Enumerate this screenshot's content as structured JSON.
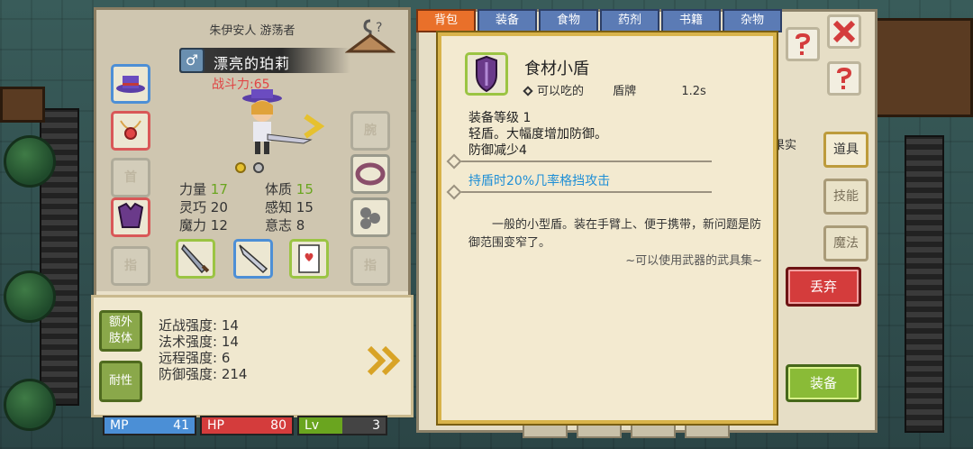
{
  "character": {
    "subtitle": "朱伊安人 游荡者",
    "name": "漂亮的珀莉",
    "gender_symbol": "♂",
    "power": "战斗力:65",
    "stats": [
      {
        "label": "力量",
        "value": "17",
        "highlight": true
      },
      {
        "label": "体质",
        "value": "15",
        "highlight": true
      },
      {
        "label": "灵巧",
        "value": "20",
        "highlight": false
      },
      {
        "label": "感知",
        "value": "15",
        "highlight": false
      },
      {
        "label": "魔力",
        "value": "12",
        "highlight": false
      },
      {
        "label": "意志",
        "value": "8",
        "highlight": false
      }
    ],
    "slot_labels": {
      "left_empty": "首",
      "right_top": "腕",
      "bottom_left": "指",
      "bottom_right": "指"
    }
  },
  "extra": {
    "btn_extra_limbs": "额外\n肢体",
    "btn_resist": "耐性",
    "strengths": [
      "近战强度: 14",
      "法术强度: 14",
      "远程强度: 6",
      "防御强度: 214"
    ]
  },
  "bars": [
    {
      "key": "MP",
      "value": "41",
      "color": "#4b8fd6",
      "fill": 1.0
    },
    {
      "key": "HP",
      "value": "80",
      "color": "#d43c3c",
      "fill": 1.0
    },
    {
      "key": "Lv",
      "value": "3",
      "color": "#6aa51f",
      "fill": 0.5
    }
  ],
  "inventory": {
    "tabs": [
      "背包",
      "装备",
      "食物",
      "药剂",
      "书籍",
      "杂物"
    ],
    "side_labels": {
      "fruit": "果实"
    },
    "right_buttons": [
      "道具",
      "技能",
      "魔法"
    ],
    "discard": "丢弃",
    "equip": "装备"
  },
  "item": {
    "title": "食材小盾",
    "meta_edible": "可以吃的",
    "meta_type": "盾牌",
    "meta_weight": "1.2s",
    "desc": [
      "装备等级 1",
      "轻盾。大幅度增加防御。",
      "防御减少4"
    ],
    "skill": "持盾时20%几率格挡攻击",
    "flavor": "一般的小型盾。装在手臂上、便于携带，新问题是防御范围变窄了。",
    "source": "~可以使用武器的武具集~"
  },
  "colors": {
    "accent_gold": "#d8b34a",
    "skill_blue": "#1f8fd6",
    "power_red": "#e04545"
  }
}
